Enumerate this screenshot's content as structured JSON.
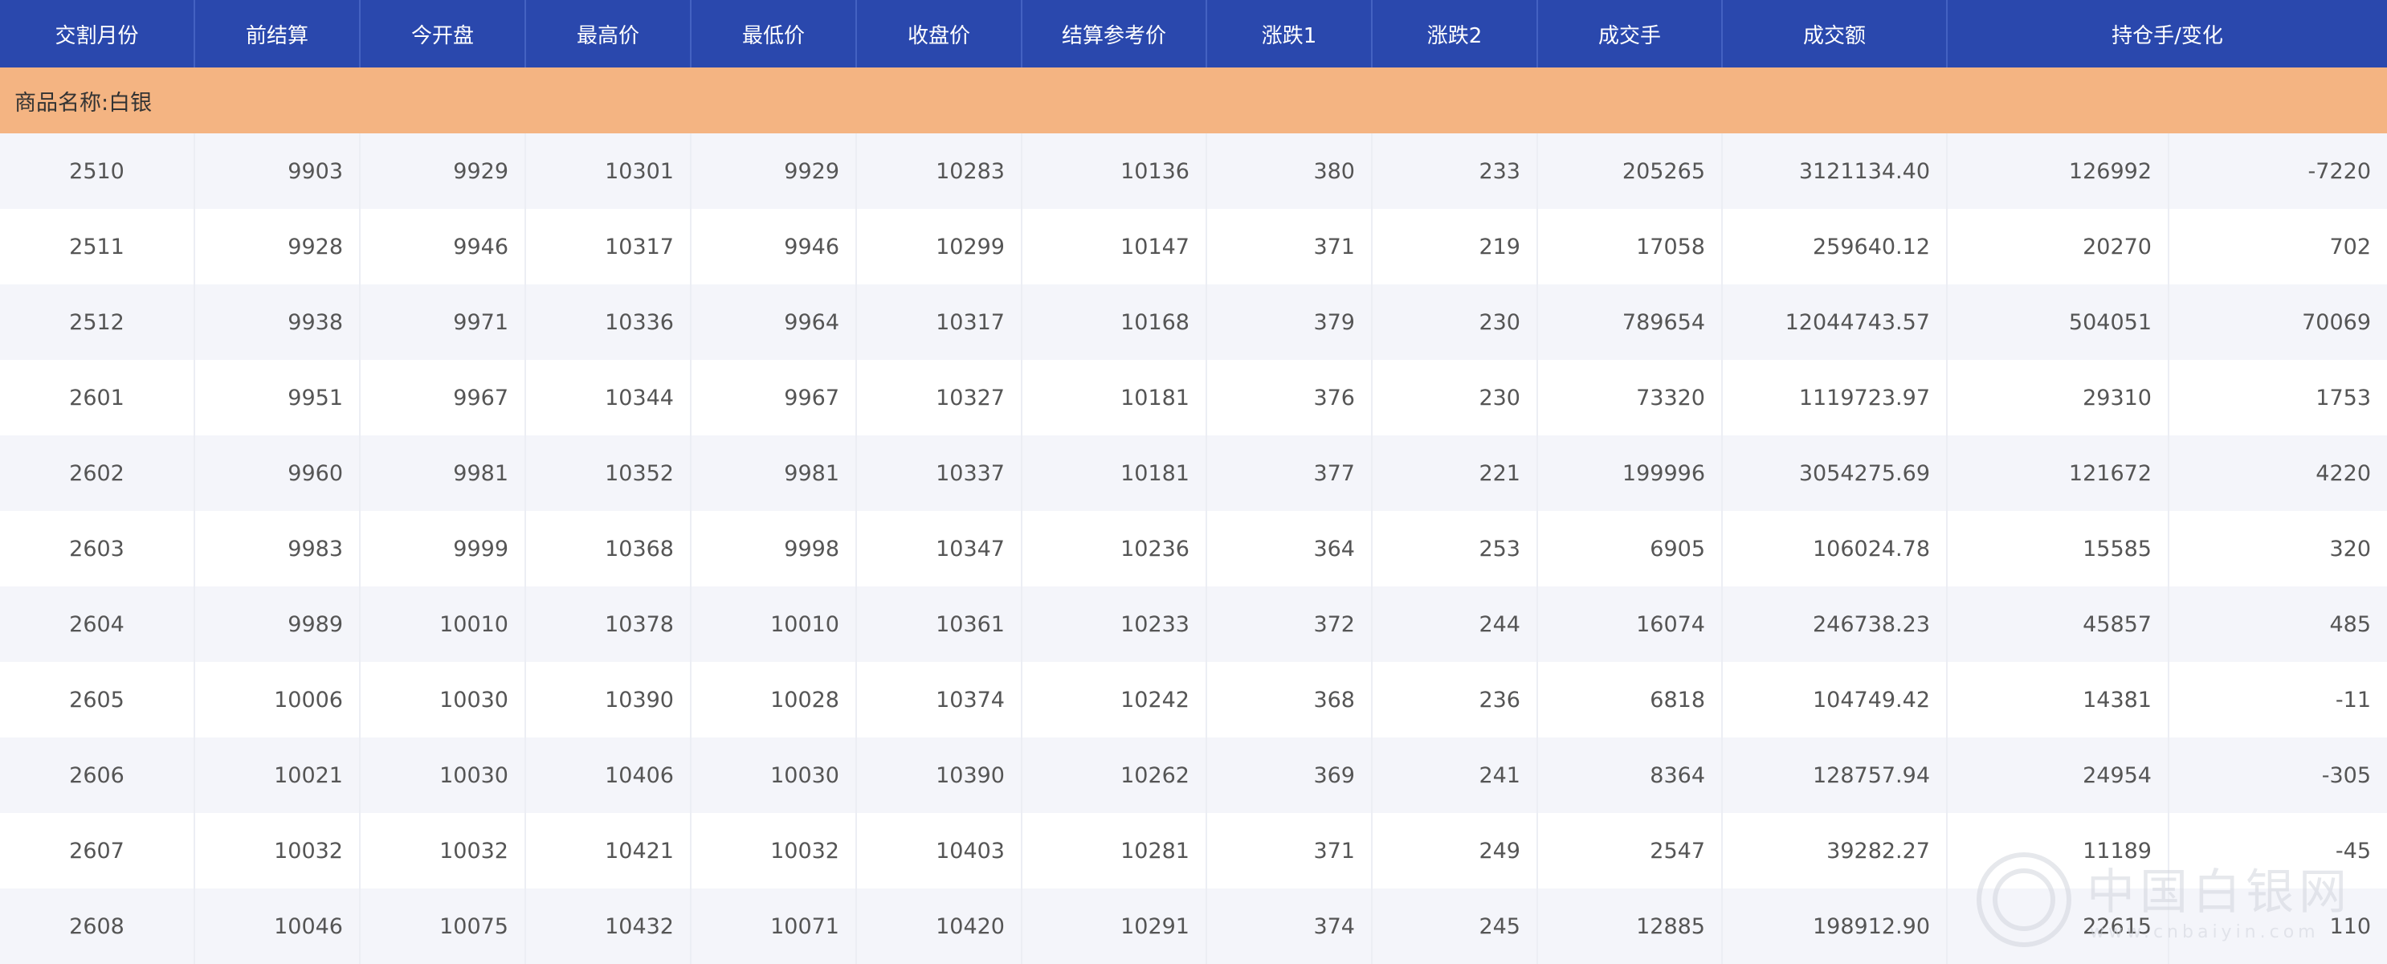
{
  "table": {
    "headers": [
      "交割月份",
      "前结算",
      "今开盘",
      "最高价",
      "最低价",
      "收盘价",
      "结算参考价",
      "涨跌1",
      "涨跌2",
      "成交手",
      "成交额",
      "持仓手/变化"
    ],
    "group_label": "商品名称:白银",
    "rows": [
      [
        "2510",
        "9903",
        "9929",
        "10301",
        "9929",
        "10283",
        "10136",
        "380",
        "233",
        "205265",
        "3121134.40",
        "126992",
        "-7220"
      ],
      [
        "2511",
        "9928",
        "9946",
        "10317",
        "9946",
        "10299",
        "10147",
        "371",
        "219",
        "17058",
        "259640.12",
        "20270",
        "702"
      ],
      [
        "2512",
        "9938",
        "9971",
        "10336",
        "9964",
        "10317",
        "10168",
        "379",
        "230",
        "789654",
        "12044743.57",
        "504051",
        "70069"
      ],
      [
        "2601",
        "9951",
        "9967",
        "10344",
        "9967",
        "10327",
        "10181",
        "376",
        "230",
        "73320",
        "1119723.97",
        "29310",
        "1753"
      ],
      [
        "2602",
        "9960",
        "9981",
        "10352",
        "9981",
        "10337",
        "10181",
        "377",
        "221",
        "199996",
        "3054275.69",
        "121672",
        "4220"
      ],
      [
        "2603",
        "9983",
        "9999",
        "10368",
        "9998",
        "10347",
        "10236",
        "364",
        "253",
        "6905",
        "106024.78",
        "15585",
        "320"
      ],
      [
        "2604",
        "9989",
        "10010",
        "10378",
        "10010",
        "10361",
        "10233",
        "372",
        "244",
        "16074",
        "246738.23",
        "45857",
        "485"
      ],
      [
        "2605",
        "10006",
        "10030",
        "10390",
        "10028",
        "10374",
        "10242",
        "368",
        "236",
        "6818",
        "104749.42",
        "14381",
        "-11"
      ],
      [
        "2606",
        "10021",
        "10030",
        "10406",
        "10030",
        "10390",
        "10262",
        "369",
        "241",
        "8364",
        "128757.94",
        "24954",
        "-305"
      ],
      [
        "2607",
        "10032",
        "10032",
        "10421",
        "10032",
        "10403",
        "10281",
        "371",
        "249",
        "2547",
        "39282.27",
        "11189",
        "-45"
      ],
      [
        "2608",
        "10046",
        "10075",
        "10432",
        "10071",
        "10420",
        "10291",
        "374",
        "245",
        "12885",
        "198912.90",
        "22615",
        "110"
      ]
    ]
  },
  "watermark": {
    "text": "中国白银网",
    "url": "www.cnbaiyin.com"
  },
  "colors": {
    "header_bg": "#2a48ad",
    "group_bg": "#f4b482",
    "row_alt_bg": "#f4f5fa"
  }
}
